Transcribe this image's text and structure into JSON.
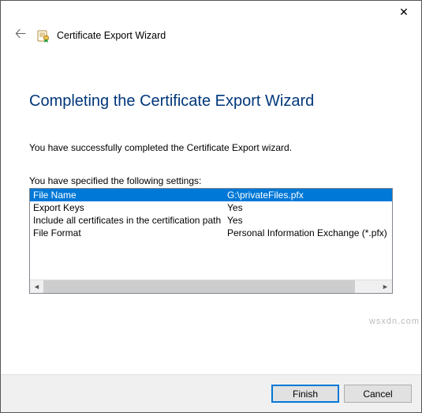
{
  "window": {
    "title": "Certificate Export Wizard"
  },
  "page": {
    "heading": "Completing the Certificate Export Wizard",
    "message": "You have successfully completed the Certificate Export wizard.",
    "subheading": "You have specified the following settings:"
  },
  "settings": {
    "rows": [
      {
        "label": "File Name",
        "value": "G:\\privateFiles.pfx",
        "selected": true
      },
      {
        "label": "Export Keys",
        "value": "Yes",
        "selected": false
      },
      {
        "label": "Include all certificates in the certification path",
        "value": "Yes",
        "selected": false
      },
      {
        "label": "File Format",
        "value": "Personal Information Exchange (*.pfx)",
        "selected": false
      }
    ]
  },
  "buttons": {
    "finish": "Finish",
    "cancel": "Cancel"
  },
  "watermark": "wsxdn.com"
}
